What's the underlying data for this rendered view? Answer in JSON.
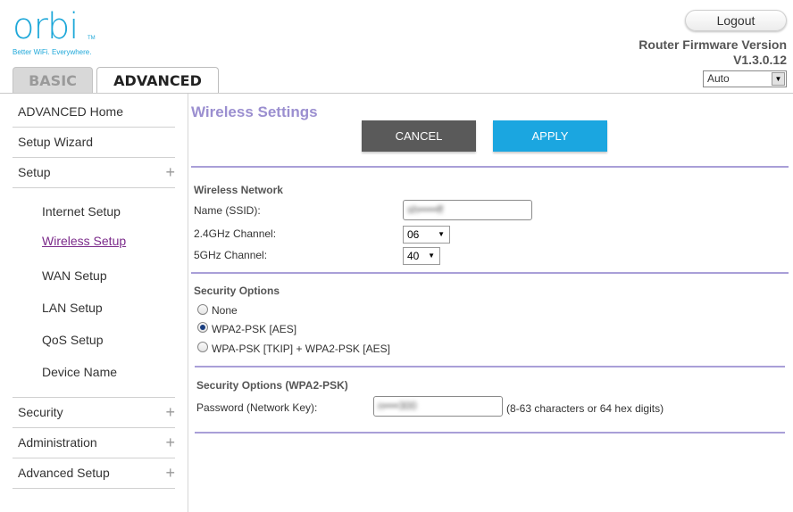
{
  "header": {
    "logo_text": "orbi",
    "logo_tm": "TM",
    "tagline": "Better WiFi. Everywhere.",
    "logout_label": "Logout",
    "firmware_label": "Router Firmware Version",
    "firmware_version": "V1.3.0.12",
    "language_selected": "Auto",
    "tabs": {
      "basic": "BASIC",
      "advanced": "ADVANCED"
    }
  },
  "sidebar": {
    "advanced_home": "ADVANCED Home",
    "setup_wizard": "Setup Wizard",
    "setup": "Setup",
    "setup_sub": {
      "internet_setup": "Internet Setup",
      "wireless_setup": "Wireless Setup",
      "wan_setup": "WAN Setup",
      "lan_setup": "LAN Setup",
      "qos_setup": "QoS Setup",
      "device_name": "Device Name"
    },
    "security": "Security",
    "administration": "Administration",
    "advanced_setup": "Advanced Setup",
    "plus": "+"
  },
  "main": {
    "title": "Wireless Settings",
    "cancel_label": "CANCEL",
    "apply_label": "APPLY",
    "wireless_network": {
      "title": "Wireless Network",
      "ssid_label": "Name (SSID):",
      "ssid_value": "sh•••••ff",
      "ch24_label": "2.4GHz Channel:",
      "ch24_value": "06",
      "ch5_label": "5GHz Channel:",
      "ch5_value": "40"
    },
    "security_options": {
      "title": "Security Options",
      "options": [
        "None",
        "WPA2-PSK [AES]",
        "WPA-PSK [TKIP] + WPA2-PSK [AES]"
      ],
      "selected_index": 1
    },
    "wpa2": {
      "title": "Security Options (WPA2-PSK)",
      "password_label": "Password (Network Key):",
      "password_value": "n••••300",
      "hint": "(8-63 characters or 64 hex digits)"
    }
  }
}
